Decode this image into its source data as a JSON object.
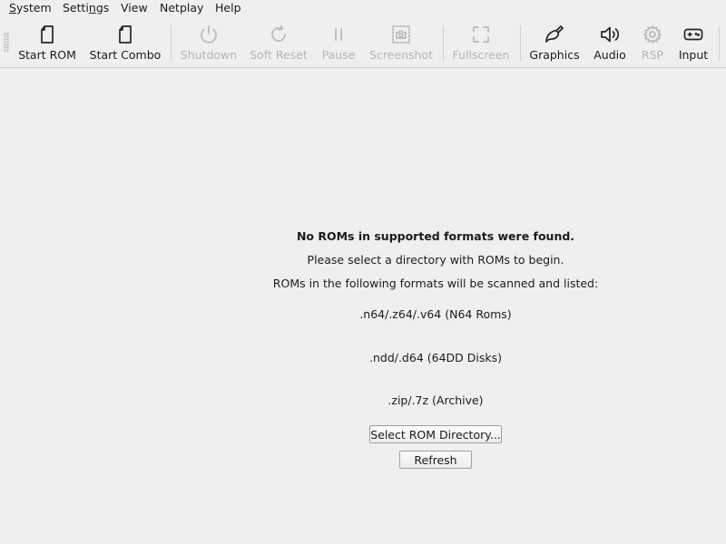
{
  "menu": {
    "items": [
      {
        "mnemonic": "S",
        "rest": "ystem"
      },
      {
        "pre": "Setti",
        "mnemonic": "n",
        "rest": "gs"
      },
      {
        "label": "View"
      },
      {
        "label": "Netplay"
      },
      {
        "label": "Help"
      }
    ]
  },
  "toolbar": {
    "buttons": [
      {
        "label": "Start ROM",
        "icon": "file-icon",
        "enabled": true
      },
      {
        "label": "Start Combo",
        "icon": "file-icon",
        "enabled": true
      },
      {
        "label": "Shutdown",
        "icon": "power-icon",
        "enabled": false
      },
      {
        "label": "Soft Reset",
        "icon": "refresh-icon",
        "enabled": false
      },
      {
        "label": "Pause",
        "icon": "pause-icon",
        "enabled": false
      },
      {
        "label": "Screenshot",
        "icon": "screenshot-icon",
        "enabled": false
      },
      {
        "label": "Fullscreen",
        "icon": "fullscreen-icon",
        "enabled": false
      },
      {
        "label": "Graphics",
        "icon": "brush-icon",
        "enabled": true
      },
      {
        "label": "Audio",
        "icon": "speaker-icon",
        "enabled": true
      },
      {
        "label": "RSP",
        "icon": "gear-icon",
        "enabled": false
      },
      {
        "label": "Input",
        "icon": "gamepad-icon",
        "enabled": true
      }
    ]
  },
  "main": {
    "heading": "No ROMs in supported formats were found.",
    "line1": "Please select a directory with ROMs to begin.",
    "line2": "ROMs in the following formats will be scanned and listed:",
    "formats": [
      ".n64/.z64/.v64 (N64 Roms)",
      ".ndd/.d64 (64DD Disks)",
      ".zip/.7z (Archive)"
    ],
    "select_button": "Select ROM Directory...",
    "refresh_button": "Refresh"
  }
}
